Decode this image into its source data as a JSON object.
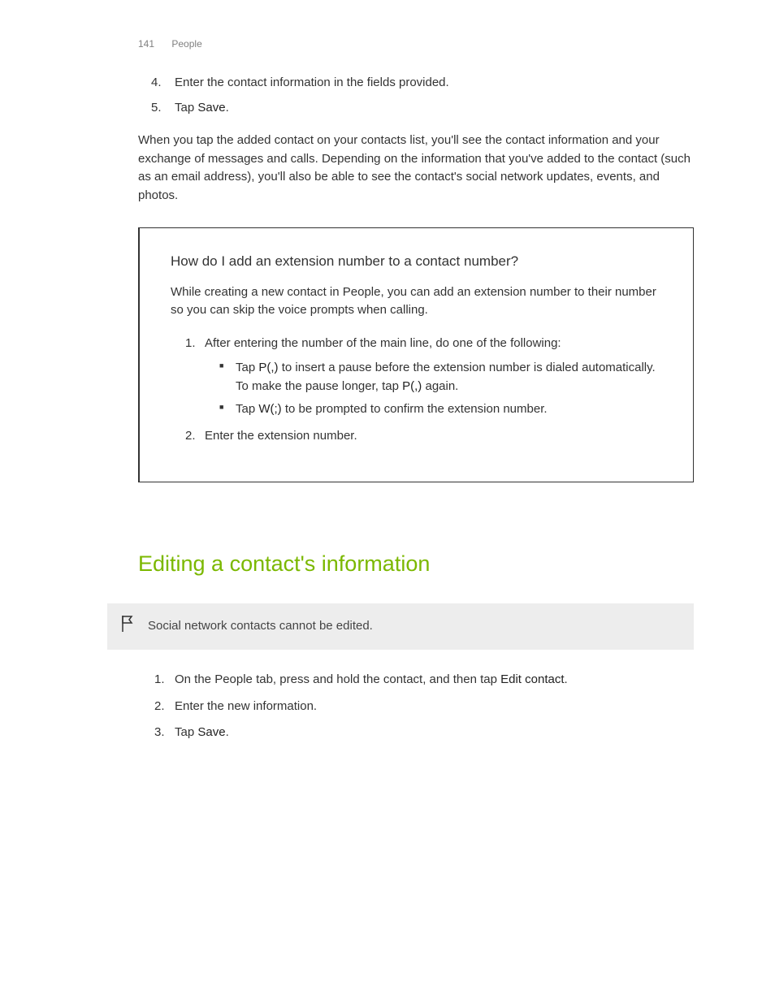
{
  "header": {
    "pageNumber": "141",
    "sectionName": "People"
  },
  "topList": {
    "items": [
      {
        "num": "4.",
        "text": "Enter the contact information in the fields provided."
      },
      {
        "num": "5.",
        "prefix": "Tap ",
        "bold": "Save",
        "suffix": "."
      }
    ]
  },
  "paragraph1": "When you tap the added contact on your contacts list, you'll see the contact information and your exchange of messages and calls. Depending on the information that you've added to the contact (such as an email address), you'll also be able to see the contact's social network updates, events, and photos.",
  "callout": {
    "title": "How do I add an extension number to a contact number?",
    "intro": "While creating a new contact in People, you can add an extension number to their number so you can skip the voice prompts when calling.",
    "step1": {
      "num": "1.",
      "text": "After entering the number of the main line, do one of the following:",
      "bullet1_prefix": "Tap ",
      "bullet1_bold1": "P(,)",
      "bullet1_mid": " to insert a pause before the extension number is dialed automatically. To make the pause longer, tap ",
      "bullet1_bold2": "P(,)",
      "bullet1_suffix": " again.",
      "bullet2_prefix": "Tap ",
      "bullet2_bold": "W(;)",
      "bullet2_suffix": " to be prompted to confirm the extension number."
    },
    "step2": {
      "num": "2.",
      "text": "Enter the extension number."
    }
  },
  "sectionHeading": "Editing a contact's information",
  "note": "Social network contacts cannot be edited.",
  "editList": {
    "item1": {
      "num": "1.",
      "prefix": "On the People tab, press and hold the contact, and then tap ",
      "bold": "Edit contact",
      "suffix": "."
    },
    "item2": {
      "num": "2.",
      "text": "Enter the new information."
    },
    "item3": {
      "num": "3.",
      "prefix": "Tap ",
      "bold": "Save",
      "suffix": "."
    }
  }
}
